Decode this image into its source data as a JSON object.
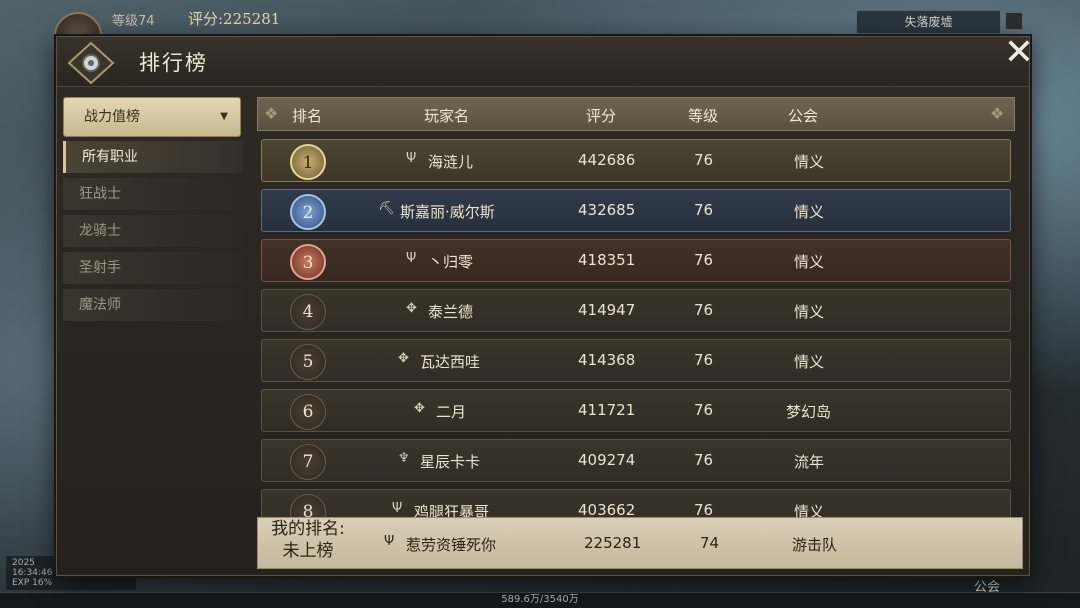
{
  "hud": {
    "level": "等级74",
    "score": "评分:225281",
    "zone": "失落废墟",
    "exp": "589.6万/3540万",
    "bottom_time": "16:34:46",
    "bottom_year": "2025",
    "exp_tag": "EXP 16%",
    "guild_button": "公会"
  },
  "panel": {
    "title": "排行榜",
    "close": "✕"
  },
  "sidebar": {
    "dropdown": "战力值榜",
    "classes": [
      "所有职业",
      "狂战士",
      "龙骑士",
      "圣射手",
      "魔法师"
    ]
  },
  "table": {
    "headers": {
      "rank": "排名",
      "name": "玩家名",
      "score": "评分",
      "level": "等级",
      "guild": "公会"
    },
    "rows": [
      {
        "rank": "1",
        "icon": "Ψ",
        "name": "海涟儿",
        "score": "442686",
        "level": "76",
        "guild": "情义"
      },
      {
        "rank": "2",
        "icon": "⛏",
        "name": "斯嘉丽·威尔斯",
        "score": "432685",
        "level": "76",
        "guild": "情义"
      },
      {
        "rank": "3",
        "icon": "Ψ",
        "name": "丶归零",
        "score": "418351",
        "level": "76",
        "guild": "情义"
      },
      {
        "rank": "4",
        "icon": "✥",
        "name": "泰兰德",
        "score": "414947",
        "level": "76",
        "guild": "情义"
      },
      {
        "rank": "5",
        "icon": "✥",
        "name": "瓦达西哇",
        "score": "414368",
        "level": "76",
        "guild": "情义"
      },
      {
        "rank": "6",
        "icon": "✥",
        "name": "二月",
        "score": "411721",
        "level": "76",
        "guild": "梦幻岛"
      },
      {
        "rank": "7",
        "icon": "♆",
        "name": "星辰卡卡",
        "score": "409274",
        "level": "76",
        "guild": "流年"
      },
      {
        "rank": "8",
        "icon": "Ψ",
        "name": "鸡腿狂暴哥",
        "score": "403662",
        "level": "76",
        "guild": "情义"
      }
    ]
  },
  "my_rank": {
    "label": "我的排名:",
    "status": "未上榜",
    "icon": "Ψ",
    "name": "惹劳资锤死你",
    "score": "225281",
    "level": "74",
    "guild": "游击队"
  },
  "colors": {
    "accent_gold": "#d6c690",
    "panel_bg": "#2a2620"
  }
}
